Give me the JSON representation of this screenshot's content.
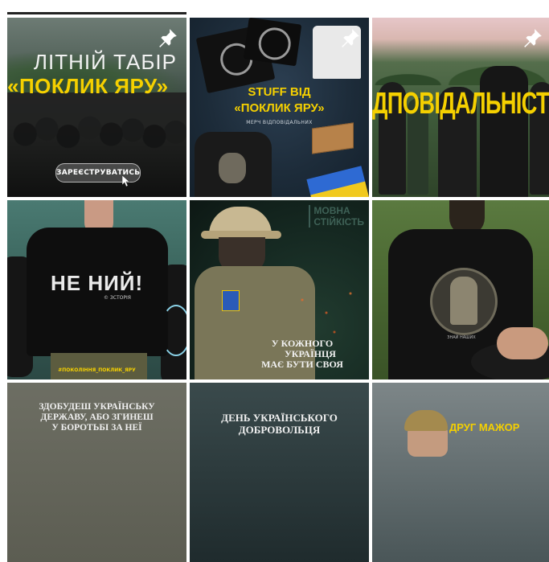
{
  "profile_tabs": {
    "active_tab": "posts"
  },
  "posts": [
    {
      "pinned": true,
      "heading_line1": "ЛІТНІЙ ТАБІР",
      "heading_line2": "«ПОКЛИК ЯРУ»",
      "button_label": "ЗАРЕЄСТРУВАТИСЬ"
    },
    {
      "pinned": true,
      "heading_line1": "STUFF ВІД",
      "heading_line2": "«ПОКЛИК ЯРУ»",
      "subtitle": "МЕРЧ ВІДПОВІДАЛЬНИХ"
    },
    {
      "pinned": true,
      "headline": "ДПОВІДАЛЬНІСТ"
    },
    {
      "slogan": "НЕ НИЙ!",
      "brand": "© ЗСТОРІЯ",
      "hashtag": "#ПОКОЛІННЯ_ПОКЛИК_ЯРУ"
    },
    {
      "watermark_line1": "МОВНА",
      "watermark_line2": "СТІЙКІСТЬ",
      "quote_line1": "У КОЖНОГО",
      "quote_line2": "УКРАЇНЦЯ",
      "quote_line3": "МАЄ БУТИ СВОЯ"
    },
    {
      "print_caption": "ЗНАЙ НАШИХ"
    },
    {
      "line1": "ЗДОБУДЕШ УКРАЇНСЬКУ",
      "line2": "ДЕРЖАВУ, АБО ЗГИНЕШ",
      "line3": "У БОРОТЬБІ ЗА НЕЇ"
    },
    {
      "line1": "ДЕНЬ УКРАЇНСЬКОГО",
      "line2": "ДОБРОВОЛЬЦЯ"
    },
    {
      "label": "ДРУГ МАЖОР"
    }
  ],
  "colors": {
    "accent_yellow": "#f5d000",
    "pin": "#ffffff"
  }
}
